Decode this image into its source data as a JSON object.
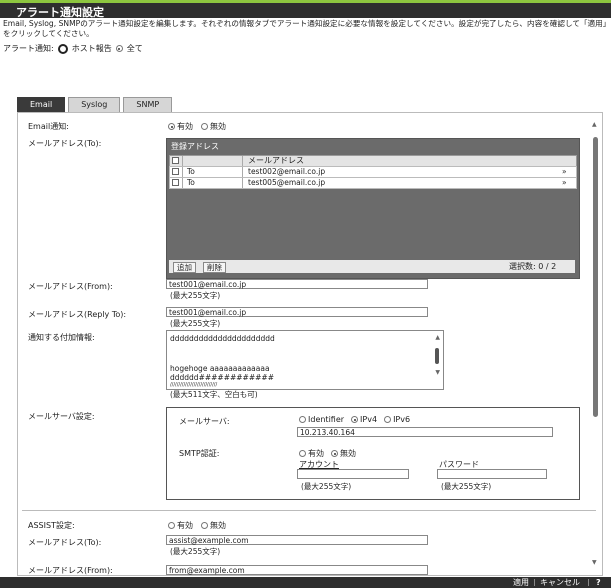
{
  "title": "アラート通知設定",
  "description": "Email, Syslog, SNMPのアラート通知設定を編集します。それぞれの情報タブでアラート通知設定に必要な情報を設定してください。設定が完了したら、内容を確認して「適用」をクリックしてください。",
  "alert_notification": {
    "label": "アラート通知:",
    "options": [
      "ホスト報告",
      "全て"
    ],
    "selected": "全て"
  },
  "tabs": [
    "Email",
    "Syslog",
    "SNMP"
  ],
  "active_tab": "Email",
  "email_notify": {
    "label": "Email通知:",
    "options": [
      "有効",
      "無効"
    ],
    "selected": "有効"
  },
  "mail_to": {
    "label": "メールアドレス(To):",
    "caption": "登録アドレス",
    "column_header": "メールアドレス",
    "rows": [
      {
        "type": "To",
        "address": "test002@email.co.jp"
      },
      {
        "type": "To",
        "address": "test005@email.co.jp"
      }
    ],
    "add_button": "追加",
    "delete_button": "削除",
    "selected_count": "選択数: 0 / 2"
  },
  "mail_from": {
    "label": "メールアドレス(From):",
    "value": "test001@email.co.jp",
    "hint": "(最大255文字)"
  },
  "reply_to": {
    "label": "メールアドレス(Reply To):",
    "value": "test001@email.co.jp",
    "hint": "(最大255文字)"
  },
  "additional_info": {
    "label": "通知する付加情報:",
    "lines": [
      "dddddddddddddddddddddd",
      "",
      "",
      "hogehoge aaaaaaaaaaaaa",
      "dddddd############",
      "////////////////////////////"
    ],
    "hint": "(最大511文字、空白も可)"
  },
  "mail_server_settings": {
    "label": "メールサーバ設定:",
    "server_label": "メールサーバ:",
    "server_options": [
      "Identifier",
      "IPv4",
      "IPv6"
    ],
    "server_selected": "IPv4",
    "server_value": "10.213.40.164",
    "smtp_label": "SMTP認証:",
    "smtp_options": [
      "有効",
      "無効"
    ],
    "smtp_selected": "無効",
    "account_label": "アカウント",
    "account_hint": "(最大255文字)",
    "password_label": "パスワード",
    "password_hint": "(最大255文字)"
  },
  "assist": {
    "label": "ASSIST設定:",
    "options": [
      "有効",
      "無効"
    ],
    "selected": "none"
  },
  "assist_to": {
    "label": "メールアドレス(To):",
    "value": "assist@example.com",
    "hint": "(最大255文字)"
  },
  "assist_from": {
    "label": "メールアドレス(From):",
    "value": "from@example.com"
  },
  "footer": {
    "apply": "適用",
    "cancel": "キャンセル",
    "help": "?"
  },
  "colors": {
    "accent": "#8dc63f",
    "titlebar": "#2e2e2e",
    "table_bg": "#6b6b6b"
  }
}
